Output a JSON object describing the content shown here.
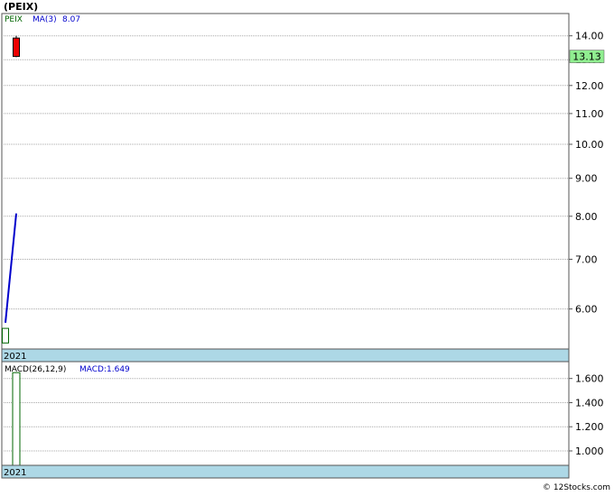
{
  "title": "(PEIX)",
  "watermark": "© 12Stocks.com",
  "colors": {
    "background": "#ffffff",
    "panel_border": "#555555",
    "grid": "#a8a8a8",
    "date_band": "#add8e6",
    "ma_line": "#0000cc",
    "candle_down": "#ee0000",
    "candle_up_outline": "#006400",
    "price_badge": "#90ee90",
    "legend_symbol": "#006400",
    "legend_ma": "#0000cc",
    "macd_text": "#000000",
    "macd_value": "#0000cc",
    "macd_bar": "#006400"
  },
  "chart_data": [
    {
      "type": "candlestick",
      "panel": "price",
      "legend": {
        "symbol": "PEIX",
        "ma_label": "MA(3)",
        "ma_value": "8.07"
      },
      "y_scale": "log",
      "ylim": [
        5.3,
        15.0
      ],
      "yticks": [
        6.0,
        7.0,
        8.0,
        9.0,
        10.0,
        11.0,
        12.0,
        13.0,
        14.0
      ],
      "ytick_labels": [
        "6.00",
        "7.00",
        "8.00",
        "9.00",
        "10.00",
        "11.00",
        "12.00",
        "13.00",
        "14.00"
      ],
      "last_price": 13.13,
      "last_price_label": "13.13",
      "date_label": "2021",
      "candles": [
        {
          "open": 5.65,
          "high": 5.65,
          "low": 5.4,
          "close": 5.4,
          "direction": "up"
        },
        {
          "open": 13.9,
          "high": 14.0,
          "low": 13.1,
          "close": 13.13,
          "direction": "down"
        }
      ],
      "ma_series": {
        "name": "MA(3)",
        "values": [
          5.75,
          8.07
        ]
      },
      "grid": true
    },
    {
      "type": "bar",
      "panel": "macd",
      "legend": {
        "label": "MACD(26,12,9)",
        "value_label": "MACD:1.649"
      },
      "ylim": [
        0.88,
        1.74
      ],
      "yticks": [
        1.0,
        1.2,
        1.4,
        1.6
      ],
      "ytick_labels": [
        "1.000",
        "1.200",
        "1.400",
        "1.600"
      ],
      "date_label": "2021",
      "values": [
        1.649
      ],
      "grid": true
    }
  ]
}
